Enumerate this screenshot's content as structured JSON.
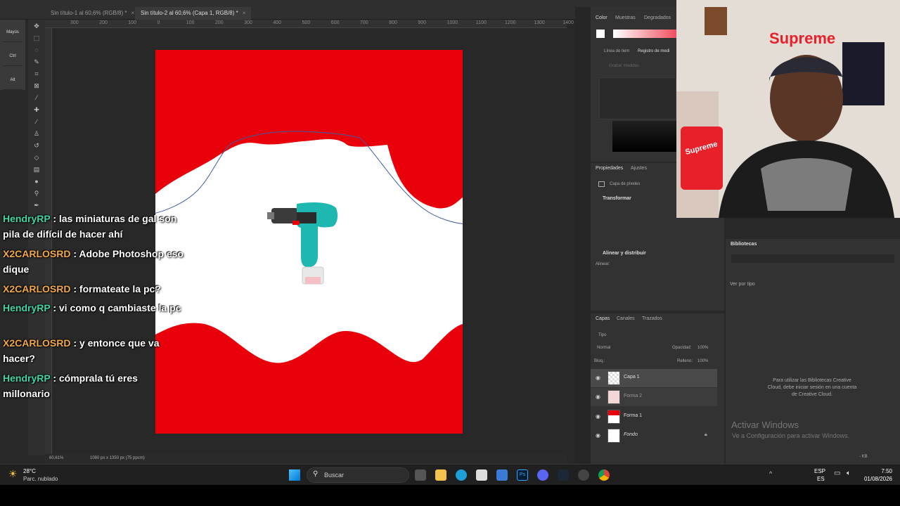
{
  "tabs": [
    {
      "label": "Sin título-1 al 60,6% (RGB/8) *",
      "active": false
    },
    {
      "label": "Sin título-2 al 60,6% (Capa 1, RGB/8) *",
      "active": true
    }
  ],
  "modifier_keys": [
    "Mayús",
    "Ctrl",
    "Alt"
  ],
  "ruler_ticks": [
    "300",
    "200",
    "100",
    "0",
    "100",
    "200",
    "300",
    "400",
    "500",
    "600",
    "700",
    "800",
    "900",
    "1000",
    "1100",
    "1200",
    "1300",
    "1400"
  ],
  "status": {
    "zoom": "60,61%",
    "doc_size": "1080 px x 1350 px (75 ppcm)"
  },
  "color_panel": {
    "tabs": [
      "Color",
      "Muestras",
      "Degradados"
    ],
    "sub_tabs": [
      "Línea de tiem",
      "Registro de medi"
    ],
    "record_btn": "Grabar medidas"
  },
  "properties": {
    "tabs": [
      "Propiedades",
      "Ajustes"
    ],
    "layer_type": "Capa de píxeles",
    "transform": "Transformar",
    "align_section": "Alinear y distribuir",
    "align_label": "Alinear:"
  },
  "layers_panel": {
    "tabs": [
      "Capas",
      "Canales",
      "Trazados"
    ],
    "filter": "Tipo",
    "blend": "Normal",
    "opacity_label": "Opacidad:",
    "opacity": "100%",
    "lock_label": "Bloq.:",
    "fill_label": "Relleno:",
    "fill": "100%",
    "layers": [
      {
        "name": "Capa 1"
      },
      {
        "name": "Forma 2"
      },
      {
        "name": "Forma 1"
      },
      {
        "name": "Fondo"
      }
    ]
  },
  "libraries": {
    "title": "Bibliotecas",
    "view": "Ver por tipo",
    "message": "Para utilizar las Bibliotecas Creative Cloud, debe iniciar sesión en una cuenta de Creative Cloud.",
    "kb": "- KB"
  },
  "activate": {
    "title": "Activar Windows",
    "subtitle": "Ve a Configuración para activar Windows."
  },
  "chat": [
    {
      "user": "HendryRP",
      "text": " : las miniaturas de gal son pila de difícil de hacer ahí",
      "color": "#3fd6a8"
    },
    {
      "user": "X2CARLOSRD",
      "text": " : Adobe Photoshop eso dique",
      "color": "#f0a848"
    },
    {
      "user": "X2CARLOSRD",
      "text": " : formateate la pc?",
      "color": "#f0a848"
    },
    {
      "user": "HendryRP",
      "text": " : vi como q cambiaste la pc",
      "color": "#3fd6a8"
    },
    {
      "user": "X2CARLOSRD",
      "text": " : y entonce que va hacer?",
      "color": "#f0a848"
    },
    {
      "user": "HendryRP",
      "text": " : cómprala tú eres millonario",
      "color": "#3fd6a8"
    }
  ],
  "webcam": {
    "sign": "Supreme",
    "sign_small": "Supreme"
  },
  "taskbar": {
    "weather_temp": "28°C",
    "weather_desc": "Parc. nublado",
    "search": "Buscar",
    "lang": "ESP",
    "lang2": "ES",
    "time": "7:50",
    "date": "01/08/2026"
  },
  "colors": {
    "accent_red": "#e8000a",
    "teal": "#1fb8b0"
  }
}
